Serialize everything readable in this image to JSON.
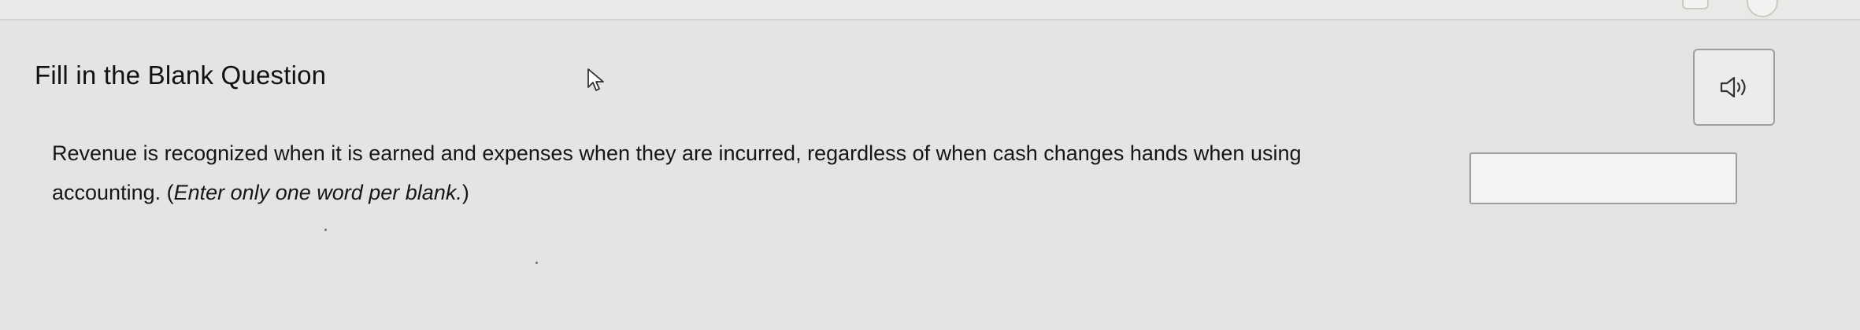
{
  "question": {
    "title": "Fill in the Blank Question",
    "text_before_blank": "Revenue is recognized when it is earned and expenses when they are incurred, regardless of when cash changes hands when using",
    "text_after_blank": "accounting.",
    "instruction_open": "(",
    "instruction": "Enter only one word per blank.",
    "instruction_close": ")",
    "blank_value": ""
  },
  "icons": {
    "audio": "speaker-icon",
    "cursor": "mouse-pointer-icon"
  },
  "colors": {
    "background": "#e4e4e2",
    "text": "#161616",
    "border": "#9f9f9d",
    "input_background": "#f4f4f2"
  }
}
